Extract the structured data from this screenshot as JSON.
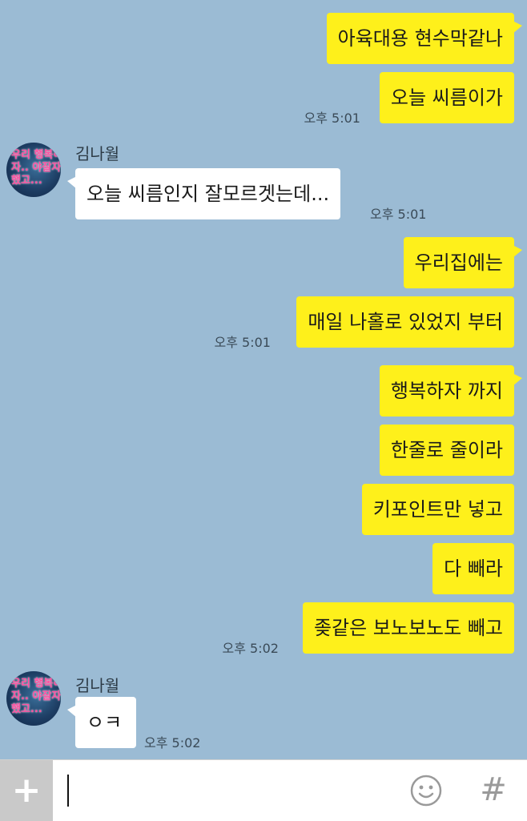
{
  "messages": {
    "m1": "아육대용 현수막같나",
    "m2": "오늘 씨름이가",
    "t1": "오후 5:01",
    "sender1": "김나월",
    "m3": "오늘 씨름인지 잘모르겟는데...",
    "t2": "오후 5:01",
    "m4": "우리집에는",
    "m5": "매일 나홀로 있었지 부터",
    "t3": "오후 5:01",
    "m6": "행복하자 까지",
    "m7": "한줄로 줄이라",
    "m8": "키포인트만 넣고",
    "m9": "다 빼라",
    "m10": "좆같은 보노보노도 빼고",
    "t4": "오후 5:02",
    "sender2": "김나월",
    "m11": "ㅇㅋ",
    "t5": "오후 5:02"
  },
  "avatar": {
    "text": "우리 행복하\n자.. 야잘자\n했고...",
    "colors": {
      "text": "#ff4fa0",
      "bg": "#1d3d63"
    }
  },
  "input_bar": {
    "plus_icon": "+",
    "hash_icon": "#",
    "emoji_icon": "smiley-icon"
  },
  "colors": {
    "background": "#9bbbd4",
    "my_bubble": "#fef01b",
    "their_bubble": "#ffffff"
  }
}
